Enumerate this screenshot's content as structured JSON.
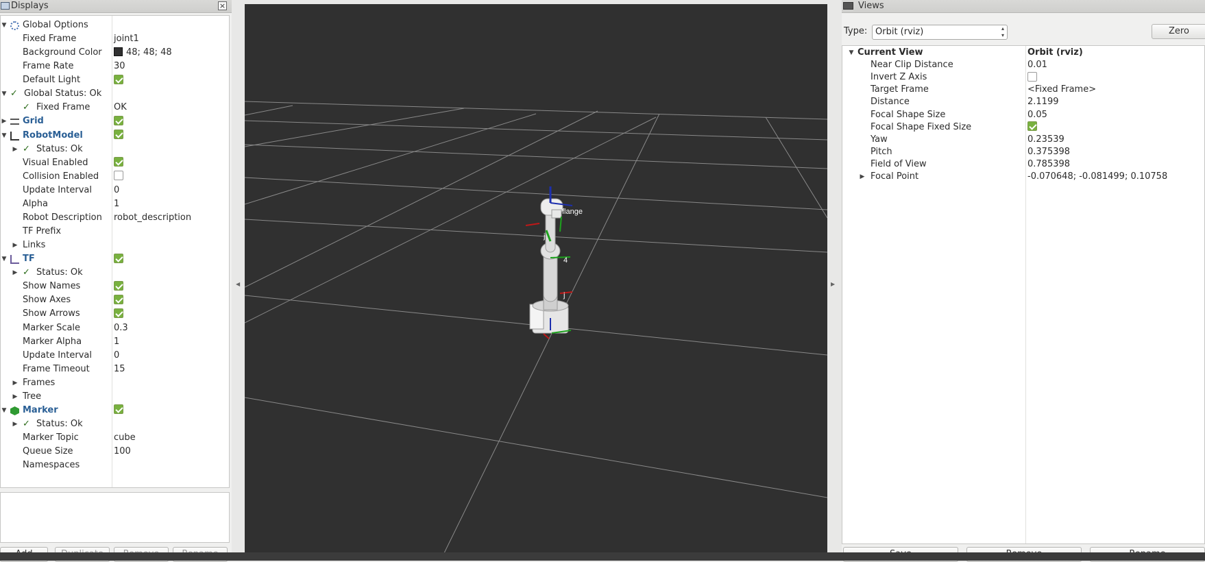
{
  "displays": {
    "title": "Displays",
    "rows": [
      {
        "level": 0,
        "arrow": "▼",
        "icon": "gear-icon",
        "name": "Global Options",
        "value": "",
        "bold": false
      },
      {
        "level": 1,
        "name": "Fixed Frame",
        "value": "joint1"
      },
      {
        "level": 1,
        "name": "Background Color",
        "value": "48; 48; 48",
        "swatch": "#303030"
      },
      {
        "level": 1,
        "name": "Frame Rate",
        "value": "30"
      },
      {
        "level": 1,
        "name": "Default Light",
        "check": true
      },
      {
        "level": 0,
        "arrow": "▼",
        "tick": true,
        "name": "Global Status: Ok",
        "value": ""
      },
      {
        "level": 1,
        "tick": true,
        "name": "Fixed Frame",
        "value": "OK"
      },
      {
        "level": 0,
        "arrow": "▶",
        "icon": "grid-icon",
        "name": "Grid",
        "bold": true,
        "check": true
      },
      {
        "level": 0,
        "arrow": "▼",
        "icon": "robot-model-icon",
        "name": "RobotModel",
        "bold": true,
        "check": true
      },
      {
        "level": 1,
        "arrow": "▶",
        "tick": true,
        "name": "Status: Ok",
        "value": ""
      },
      {
        "level": 1,
        "name": "Visual Enabled",
        "check": true
      },
      {
        "level": 1,
        "name": "Collision Enabled",
        "check": false
      },
      {
        "level": 1,
        "name": "Update Interval",
        "value": "0"
      },
      {
        "level": 1,
        "name": "Alpha",
        "value": "1"
      },
      {
        "level": 1,
        "name": "Robot Description",
        "value": "robot_description"
      },
      {
        "level": 1,
        "name": "TF Prefix",
        "value": ""
      },
      {
        "level": 1,
        "arrow": "▶",
        "name": "Links",
        "value": ""
      },
      {
        "level": 0,
        "arrow": "▼",
        "icon": "tf-icon",
        "name": "TF",
        "bold": true,
        "check": true
      },
      {
        "level": 1,
        "arrow": "▶",
        "tick": true,
        "name": "Status: Ok",
        "value": ""
      },
      {
        "level": 1,
        "name": "Show Names",
        "check": true
      },
      {
        "level": 1,
        "name": "Show Axes",
        "check": true
      },
      {
        "level": 1,
        "name": "Show Arrows",
        "check": true
      },
      {
        "level": 1,
        "name": "Marker Scale",
        "value": "0.3"
      },
      {
        "level": 1,
        "name": "Marker Alpha",
        "value": "1"
      },
      {
        "level": 1,
        "name": "Update Interval",
        "value": "0"
      },
      {
        "level": 1,
        "name": "Frame Timeout",
        "value": "15"
      },
      {
        "level": 1,
        "arrow": "▶",
        "name": "Frames",
        "value": ""
      },
      {
        "level": 1,
        "arrow": "▶",
        "name": "Tree",
        "value": ""
      },
      {
        "level": 0,
        "arrow": "▼",
        "icon": "marker-icon",
        "name": "Marker",
        "bold": true,
        "check": true
      },
      {
        "level": 1,
        "arrow": "▶",
        "tick": true,
        "name": "Status: Ok",
        "value": ""
      },
      {
        "level": 1,
        "name": "Marker Topic",
        "value": "cube"
      },
      {
        "level": 1,
        "name": "Queue Size",
        "value": "100"
      },
      {
        "level": 1,
        "name": "Namespaces",
        "value": ""
      }
    ],
    "buttons": [
      "Add",
      "Duplicate",
      "Remove",
      "Rename"
    ]
  },
  "viewport": {
    "background": "#303030",
    "grid_color": "#8a8a8a",
    "labels": [
      "flange",
      "j",
      "4",
      "j"
    ]
  },
  "views": {
    "title": "Views",
    "type_label": "Type:",
    "type_value": "Orbit (rviz)",
    "zero_label": "Zero",
    "rows": [
      {
        "level": 0,
        "arrow": "▼",
        "name": "Current View",
        "value": "Orbit (rviz)",
        "bold": true
      },
      {
        "level": 1,
        "name": "Near Clip Distance",
        "value": "0.01"
      },
      {
        "level": 1,
        "name": "Invert Z Axis",
        "check": false
      },
      {
        "level": 1,
        "name": "Target Frame",
        "value": "<Fixed Frame>"
      },
      {
        "level": 1,
        "name": "Distance",
        "value": "2.1199"
      },
      {
        "level": 1,
        "name": "Focal Shape Size",
        "value": "0.05"
      },
      {
        "level": 1,
        "name": "Focal Shape Fixed Size",
        "check": true
      },
      {
        "level": 1,
        "name": "Yaw",
        "value": "0.23539"
      },
      {
        "level": 1,
        "name": "Pitch",
        "value": "0.375398"
      },
      {
        "level": 1,
        "name": "Field of View",
        "value": "0.785398"
      },
      {
        "level": 1,
        "arrow": "▶",
        "name": "Focal Point",
        "value": "-0.070648; -0.081499; 0.10758"
      }
    ],
    "buttons": [
      "Save",
      "Remove",
      "Rename"
    ]
  }
}
